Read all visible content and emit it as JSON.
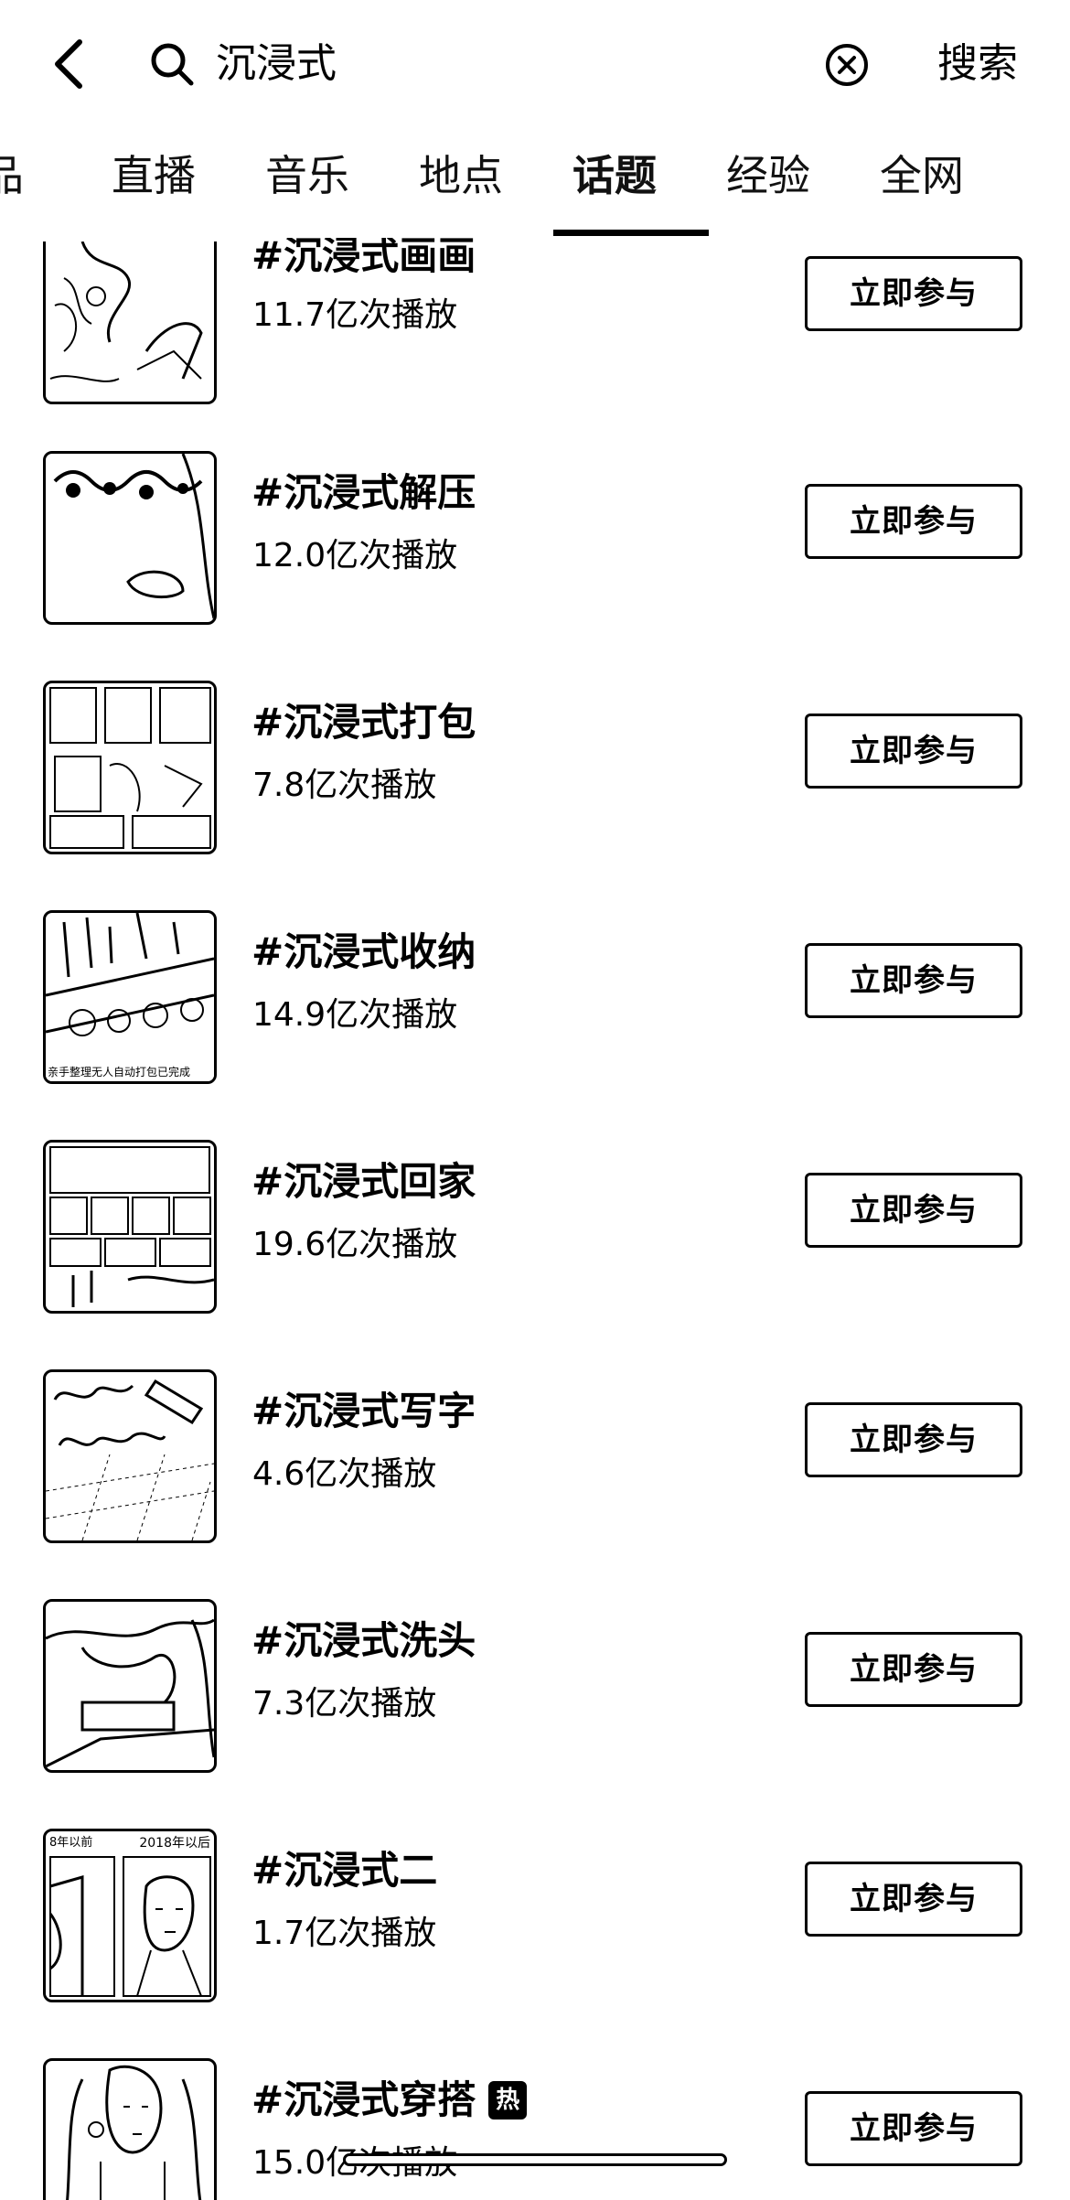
{
  "search": {
    "query": "沉浸式",
    "submit_label": "搜索"
  },
  "tabs": [
    {
      "label": "品"
    },
    {
      "label": "直播"
    },
    {
      "label": "音乐"
    },
    {
      "label": "地点"
    },
    {
      "label": "话题",
      "active": true
    },
    {
      "label": "经验"
    },
    {
      "label": "全网"
    }
  ],
  "topics": [
    {
      "title": "#沉浸式画画",
      "plays": "11.7亿次播放",
      "button": "立即参与"
    },
    {
      "title": "#沉浸式解压",
      "plays": "12.0亿次播放",
      "button": "立即参与"
    },
    {
      "title": "#沉浸式打包",
      "plays": "7.8亿次播放",
      "button": "立即参与"
    },
    {
      "title": "#沉浸式收纳",
      "plays": "14.9亿次播放",
      "button": "立即参与"
    },
    {
      "title": "#沉浸式回家",
      "plays": "19.6亿次播放",
      "button": "立即参与"
    },
    {
      "title": "#沉浸式写字",
      "plays": "4.6亿次播放",
      "button": "立即参与"
    },
    {
      "title": "#沉浸式洗头",
      "plays": "7.3亿次播放",
      "button": "立即参与"
    },
    {
      "title": "#沉浸式二",
      "plays": "1.7亿次播放",
      "button": "立即参与"
    },
    {
      "title": "#沉浸式穿搭",
      "plays": "15.0亿次播放",
      "button": "立即参与",
      "badge": "热"
    }
  ],
  "thumb_text": {
    "collection_caption": "亲手整理无人自动打包已完成",
    "comparison_left": "8年以前",
    "comparison_right": "2018年以后"
  }
}
